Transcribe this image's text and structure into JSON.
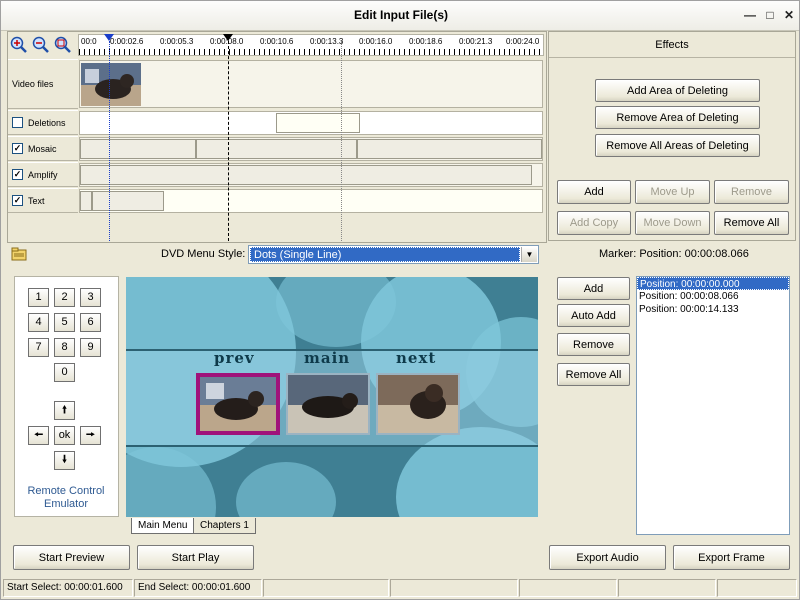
{
  "window": {
    "title": "Edit Input File(s)"
  },
  "timeline": {
    "ticks": [
      "00:0",
      "0:00:02.6",
      "0:00:05.3",
      "0:00:08.0",
      "0:00:10.6",
      "0:00:13.3",
      "0:00:16.0",
      "0:00:18.6",
      "0:00:21.3",
      "0:00:24.0"
    ],
    "tracks": {
      "video": "Video files",
      "deletions": "Deletions",
      "mosaic": "Mosaic",
      "amplify": "Amplify",
      "text": "Text"
    },
    "checked": {
      "deletions": false,
      "mosaic": true,
      "amplify": true,
      "text": true
    }
  },
  "effects": {
    "header": "Effects",
    "add_area": "Add Area of Deleting",
    "remove_area": "Remove Area of Deleting",
    "remove_all_areas": "Remove All Areas of Deleting",
    "add": "Add",
    "move_up": "Move Up",
    "remove": "Remove",
    "add_copy": "Add Copy",
    "move_down": "Move Down",
    "remove_all": "Remove All"
  },
  "dvd_menu": {
    "label": "DVD Menu Style:",
    "selected": "Dots (Single Line)",
    "nav": {
      "prev": "prev",
      "main": "main",
      "next": "next"
    },
    "tabs": [
      "Main Menu",
      "Chapters 1"
    ]
  },
  "remote": {
    "keys": [
      "1",
      "2",
      "3",
      "4",
      "5",
      "6",
      "7",
      "8",
      "9",
      "0"
    ],
    "ok": "ok",
    "label": "Remote Control Emulator"
  },
  "markers": {
    "header": "Marker: Position: 00:00:08.066",
    "add": "Add",
    "auto_add": "Auto Add",
    "remove": "Remove",
    "remove_all": "Remove All",
    "list": [
      "Position: 00:00:00.000",
      "Position: 00:00:08.066",
      "Position: 00:00:14.133"
    ]
  },
  "footer": {
    "start_preview": "Start Preview",
    "start_play": "Start Play",
    "export_audio": "Export Audio",
    "export_frame": "Export Frame"
  },
  "status": {
    "start_select": "Start Select: 00:00:01.600",
    "end_select": "End Select: 00:00:01.600"
  }
}
